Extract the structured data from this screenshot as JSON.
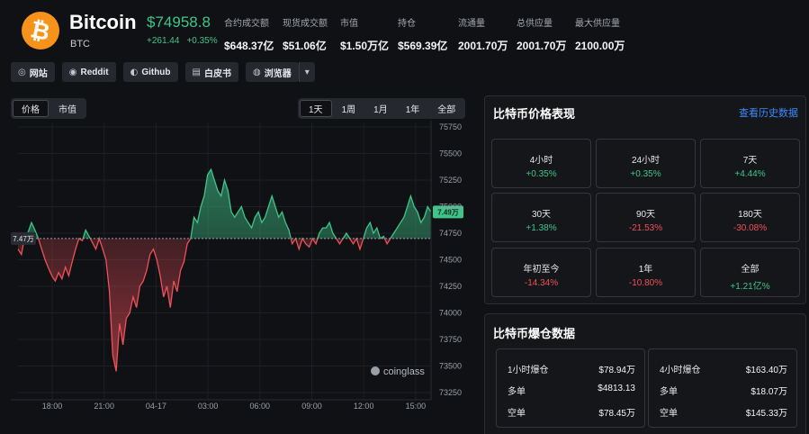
{
  "coin": {
    "logo_glyph": "₿",
    "name": "Bitcoin",
    "symbol": "BTC",
    "price": "$74958.8",
    "change_abs": "+261.44",
    "change_pct": "+0.35%"
  },
  "stats": [
    {
      "label": "合约成交额",
      "value": "$648.37亿"
    },
    {
      "label": "现货成交额",
      "value": "$51.06亿"
    },
    {
      "label": "市值",
      "value": "$1.50万亿"
    },
    {
      "label": "持仓",
      "value": "$569.39亿"
    },
    {
      "label": "流通量",
      "value": "2001.70万"
    },
    {
      "label": "总供应量",
      "value": "2001.70万"
    },
    {
      "label": "最大供应量",
      "value": "2100.00万"
    }
  ],
  "links": [
    {
      "icon": "globe-icon",
      "glyph": "◎",
      "label": "网站"
    },
    {
      "icon": "reddit-icon",
      "glyph": "◉",
      "label": "Reddit"
    },
    {
      "icon": "github-icon",
      "glyph": "◐",
      "label": "Github"
    },
    {
      "icon": "document-icon",
      "glyph": "▤",
      "label": "白皮书"
    },
    {
      "icon": "explorer-icon",
      "glyph": "◍",
      "label": "浏览器"
    }
  ],
  "links_more_glyph": "▾",
  "chart_tabs": [
    {
      "label": "价格",
      "active": true
    },
    {
      "label": "市值",
      "active": false
    }
  ],
  "range_tabs": [
    {
      "label": "1天",
      "active": true
    },
    {
      "label": "1周",
      "active": false
    },
    {
      "label": "1月",
      "active": false
    },
    {
      "label": "1年",
      "active": false
    },
    {
      "label": "全部",
      "active": false
    }
  ],
  "watermark": "coinglass",
  "chart_data": {
    "type": "area",
    "baseline": 74700,
    "baseline_label": "7.47万",
    "current_label": "7.49万",
    "ylim": [
      73250,
      75750
    ],
    "y_ticks": [
      "75750",
      "75500",
      "75250",
      "75000",
      "74750",
      "74500",
      "74250",
      "74000",
      "73750",
      "73500",
      "73250"
    ],
    "x_ticks": [
      "18:00",
      "21:00",
      "04-17",
      "03:00",
      "06:00",
      "09:00",
      "12:00",
      "15:00"
    ],
    "series": [
      {
        "values": [
          74600,
          74550,
          74720,
          74760,
          74850,
          74780,
          74700,
          74600,
          74500,
          74420,
          74350,
          74300,
          74380,
          74320,
          74430,
          74350,
          74480,
          74600,
          74700,
          74680,
          74780,
          74720,
          74660,
          74600,
          74700,
          74600,
          74500,
          74200,
          73600,
          73450,
          73900,
          73700,
          73950,
          74000,
          74150,
          74050,
          74250,
          74300,
          74400,
          74550,
          74600,
          74500,
          74350,
          74150,
          74250,
          74050,
          74300,
          74200,
          74400,
          74480,
          74650,
          74700,
          74900,
          74850,
          75000,
          75100,
          75300,
          75350,
          75250,
          75150,
          75100,
          75250,
          75150,
          74950,
          74900,
          74950,
          75000,
          74900,
          74850,
          74800,
          74900,
          74950,
          74850,
          74900,
          75000,
          75100,
          75000,
          74900,
          74950,
          74850,
          74780,
          74650,
          74700,
          74600,
          74700,
          74650,
          74620,
          74700,
          74650,
          74750,
          74800,
          74800,
          74850,
          74750,
          74700,
          74650,
          74700,
          74750,
          74700,
          74650,
          74700,
          74600,
          74700,
          74800,
          74850,
          74750,
          74800,
          74700,
          74720,
          74650,
          74700,
          74750,
          74800,
          74850,
          74900,
          75000,
          75100,
          75000,
          74950,
          74850,
          74900,
          75000,
          74950
        ]
      }
    ]
  },
  "performance": {
    "title": "比特币价格表现",
    "link": "查看历史数据",
    "cells": [
      {
        "label": "4小时",
        "value": "+0.35%",
        "sign": "pos"
      },
      {
        "label": "24小时",
        "value": "+0.35%",
        "sign": "pos"
      },
      {
        "label": "7天",
        "value": "+4.44%",
        "sign": "pos"
      },
      {
        "label": "30天",
        "value": "+1.38%",
        "sign": "pos"
      },
      {
        "label": "90天",
        "value": "-21.53%",
        "sign": "neg"
      },
      {
        "label": "180天",
        "value": "-30.08%",
        "sign": "neg"
      },
      {
        "label": "年初至今",
        "value": "-14.34%",
        "sign": "neg"
      },
      {
        "label": "1年",
        "value": "-10.80%",
        "sign": "neg"
      },
      {
        "label": "全部",
        "value": "+1.21亿%",
        "sign": "pos"
      }
    ]
  },
  "liquidation": {
    "title": "比特币爆仓数据",
    "boxes": [
      {
        "title": "1小时爆仓",
        "total": "$78.94万",
        "long_label": "多单",
        "long": "$4813.13",
        "short_label": "空单",
        "short": "$78.45万"
      },
      {
        "title": "4小时爆仓",
        "total": "$163.40万",
        "long_label": "多单",
        "long": "$18.07万",
        "short_label": "空单",
        "short": "$145.33万"
      }
    ]
  },
  "colors": {
    "up": "#3fc58a",
    "down": "#f0505a",
    "accent": "#f7931a",
    "link": "#3d8bfd"
  }
}
